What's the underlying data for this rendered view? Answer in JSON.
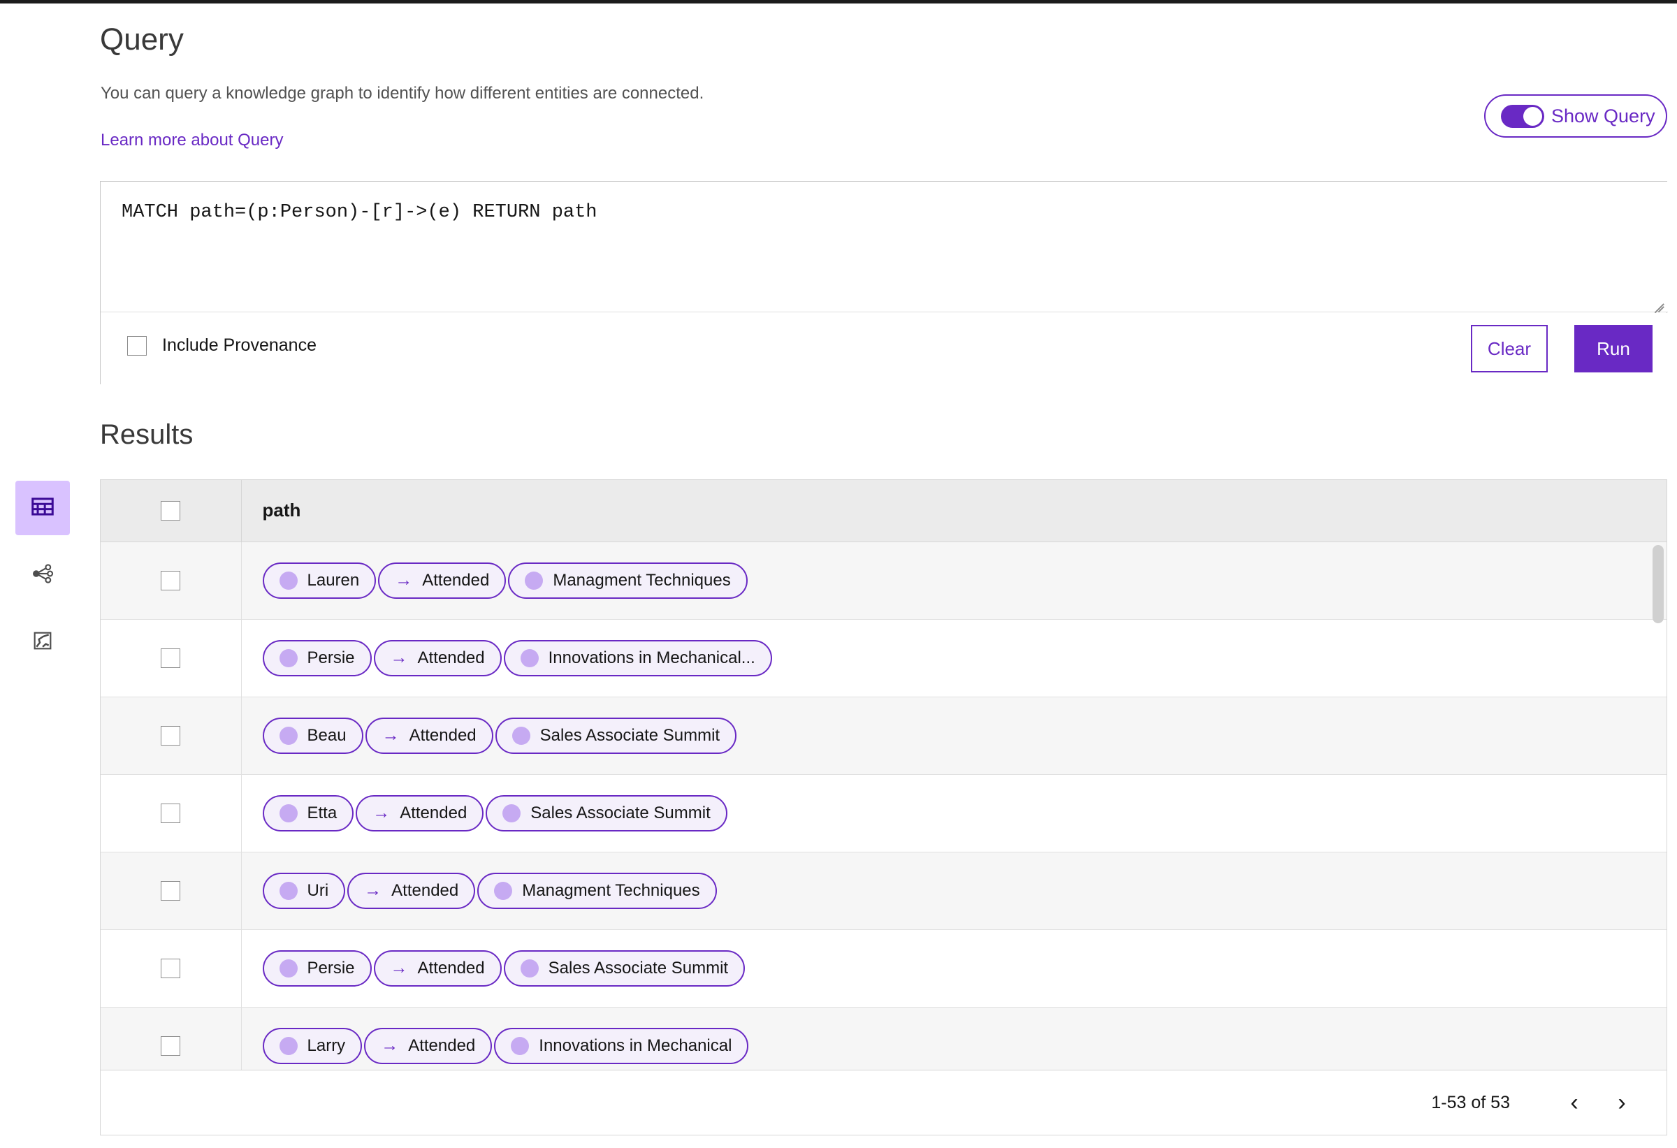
{
  "page": {
    "title": "Query",
    "description": "You can query a knowledge graph to identify how different entities are connected.",
    "learn_more_label": "Learn more about Query",
    "results_title": "Results",
    "accent_color": "#6929c4",
    "chip_fill_color": "#f4f0fb",
    "chip_dot_color": "#c6aaf2"
  },
  "show_query_toggle": {
    "label": "Show Query",
    "state": "on"
  },
  "query_editor": {
    "value": "MATCH path=(p:Person)-[r]->(e) RETURN path",
    "placeholder": "",
    "include_provenance_label": "Include Provenance",
    "include_provenance_checked": false,
    "clear_label": "Clear",
    "run_label": "Run"
  },
  "view_modes": [
    {
      "name": "table-view",
      "icon": "table-icon",
      "active": true
    },
    {
      "name": "graph-view",
      "icon": "network-icon",
      "active": false
    },
    {
      "name": "map-view",
      "icon": "map-icon",
      "active": false
    }
  ],
  "results_table": {
    "columns": [
      "path"
    ],
    "select_all_checked": false,
    "rows": [
      {
        "checked": false,
        "chips": [
          {
            "type": "node",
            "label": "Lauren"
          },
          {
            "type": "rel",
            "label": "Attended"
          },
          {
            "type": "node",
            "label": "Managment Techniques"
          }
        ]
      },
      {
        "checked": false,
        "chips": [
          {
            "type": "node",
            "label": "Persie"
          },
          {
            "type": "rel",
            "label": "Attended"
          },
          {
            "type": "node",
            "label": "Innovations in Mechanical..."
          }
        ]
      },
      {
        "checked": false,
        "chips": [
          {
            "type": "node",
            "label": "Beau"
          },
          {
            "type": "rel",
            "label": "Attended"
          },
          {
            "type": "node",
            "label": "Sales Associate Summit"
          }
        ]
      },
      {
        "checked": false,
        "chips": [
          {
            "type": "node",
            "label": "Etta"
          },
          {
            "type": "rel",
            "label": "Attended"
          },
          {
            "type": "node",
            "label": "Sales Associate Summit"
          }
        ]
      },
      {
        "checked": false,
        "chips": [
          {
            "type": "node",
            "label": "Uri"
          },
          {
            "type": "rel",
            "label": "Attended"
          },
          {
            "type": "node",
            "label": "Managment Techniques"
          }
        ]
      },
      {
        "checked": false,
        "chips": [
          {
            "type": "node",
            "label": "Persie"
          },
          {
            "type": "rel",
            "label": "Attended"
          },
          {
            "type": "node",
            "label": "Sales Associate Summit"
          }
        ]
      },
      {
        "checked": false,
        "chips": [
          {
            "type": "node",
            "label": "Larry"
          },
          {
            "type": "rel",
            "label": "Attended"
          },
          {
            "type": "node",
            "label": "Innovations in Mechanical"
          }
        ]
      }
    ]
  },
  "pagination": {
    "range_label": "1-53 of 53",
    "prev_glyph": "‹",
    "next_glyph": "›"
  },
  "icons": {
    "arrow_right": "→"
  }
}
